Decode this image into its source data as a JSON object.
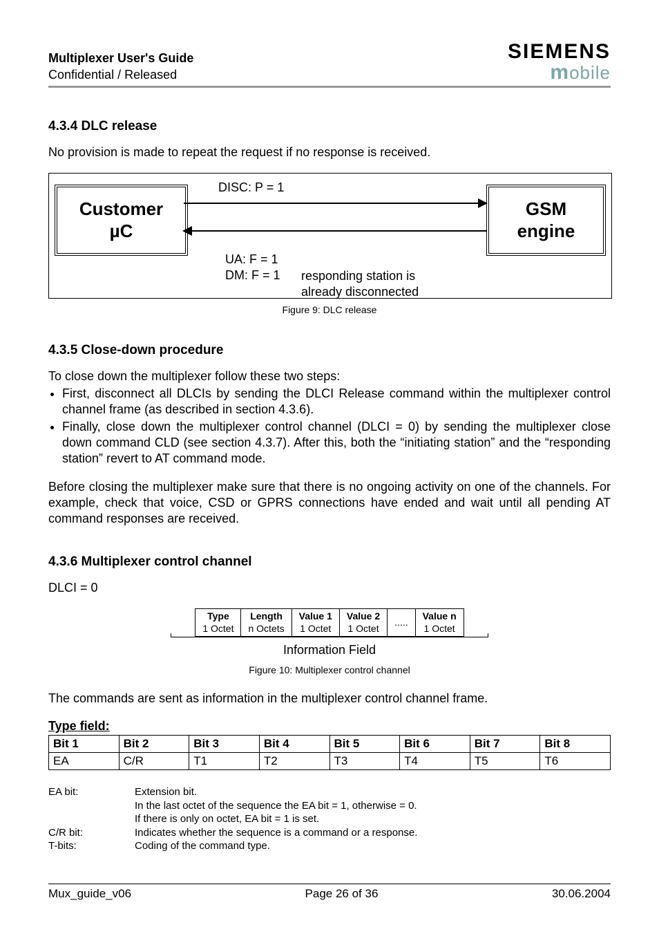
{
  "header": {
    "title": "Multiplexer User's Guide",
    "sub": "Confidential / Released",
    "brand_top": "SIEMENS",
    "brand_bottom_m": "m",
    "brand_bottom_rest": "obile"
  },
  "s434": {
    "heading": "4.3.4  DLC release",
    "para": "No provision is made to repeat the request if no response is received.",
    "customer_l1": "Customer",
    "customer_l2": "µC",
    "gsm_l1": "GSM",
    "gsm_l2": "engine",
    "disc": "DISC: P = 1",
    "ua": "UA: F = 1",
    "dm": "DM: F = 1",
    "dm_desc_l1": "responding station is",
    "dm_desc_l2": "already disconnected",
    "caption": "Figure 9: DLC release"
  },
  "s435": {
    "heading": "4.3.5  Close-down procedure",
    "intro": "To close down the multiplexer follow these two steps:",
    "b1": "First, disconnect all DLCIs by sending the DLCI Release command within the multiplexer control channel frame (as described in section 4.3.6).",
    "b2": "Finally, close down the multiplexer control channel (DLCI = 0) by sending the multiplexer close down command CLD (see section 4.3.7). After this, both the “initiating station” and the “responding station” revert to AT command mode.",
    "para2": "Before closing the multiplexer make sure that there is no ongoing activity on one of the channels. For example, check that voice, CSD or GPRS connections have ended and wait until all pending AT command  responses are received."
  },
  "s436": {
    "heading": "4.3.6  Multiplexer control channel",
    "dlci": "DLCI = 0",
    "cols": [
      {
        "h": "Type",
        "s": "1 Octet"
      },
      {
        "h": "Length",
        "s": "n Octets"
      },
      {
        "h": "Value 1",
        "s": "1 Octet"
      },
      {
        "h": "Value 2",
        "s": "1 Octet"
      },
      {
        "h": ".....",
        "s": ""
      },
      {
        "h": "Value n",
        "s": "1 Octet"
      }
    ],
    "info_label": "Information Field",
    "caption": "Figure 10: Multiplexer control channel",
    "para": "The commands are sent as information in the multiplexer control channel frame."
  },
  "typefield": {
    "heading": "Type field:",
    "headers": [
      "Bit 1",
      "Bit 2",
      "Bit 3",
      "Bit 4",
      "Bit 5",
      "Bit 6",
      "Bit 7",
      "Bit 8"
    ],
    "row": [
      "EA",
      "C/R",
      "T1",
      "T2",
      "T3",
      "T4",
      "T5",
      "T6"
    ]
  },
  "defs": {
    "ea_label": "EA bit:",
    "ea_l1": "Extension bit.",
    "ea_l2": "In the last octet of the sequence the EA bit = 1, otherwise  = 0.",
    "ea_l3": "If there is only on octet, EA bit = 1 is set.",
    "cr_label": "C/R bit:",
    "cr": "Indicates whether the sequence is a command or a response.",
    "t_label": "T-bits:",
    "t": "Coding of the command type."
  },
  "footer": {
    "left": "Mux_guide_v06",
    "center": "Page 26 of 36",
    "right": "30.06.2004"
  }
}
